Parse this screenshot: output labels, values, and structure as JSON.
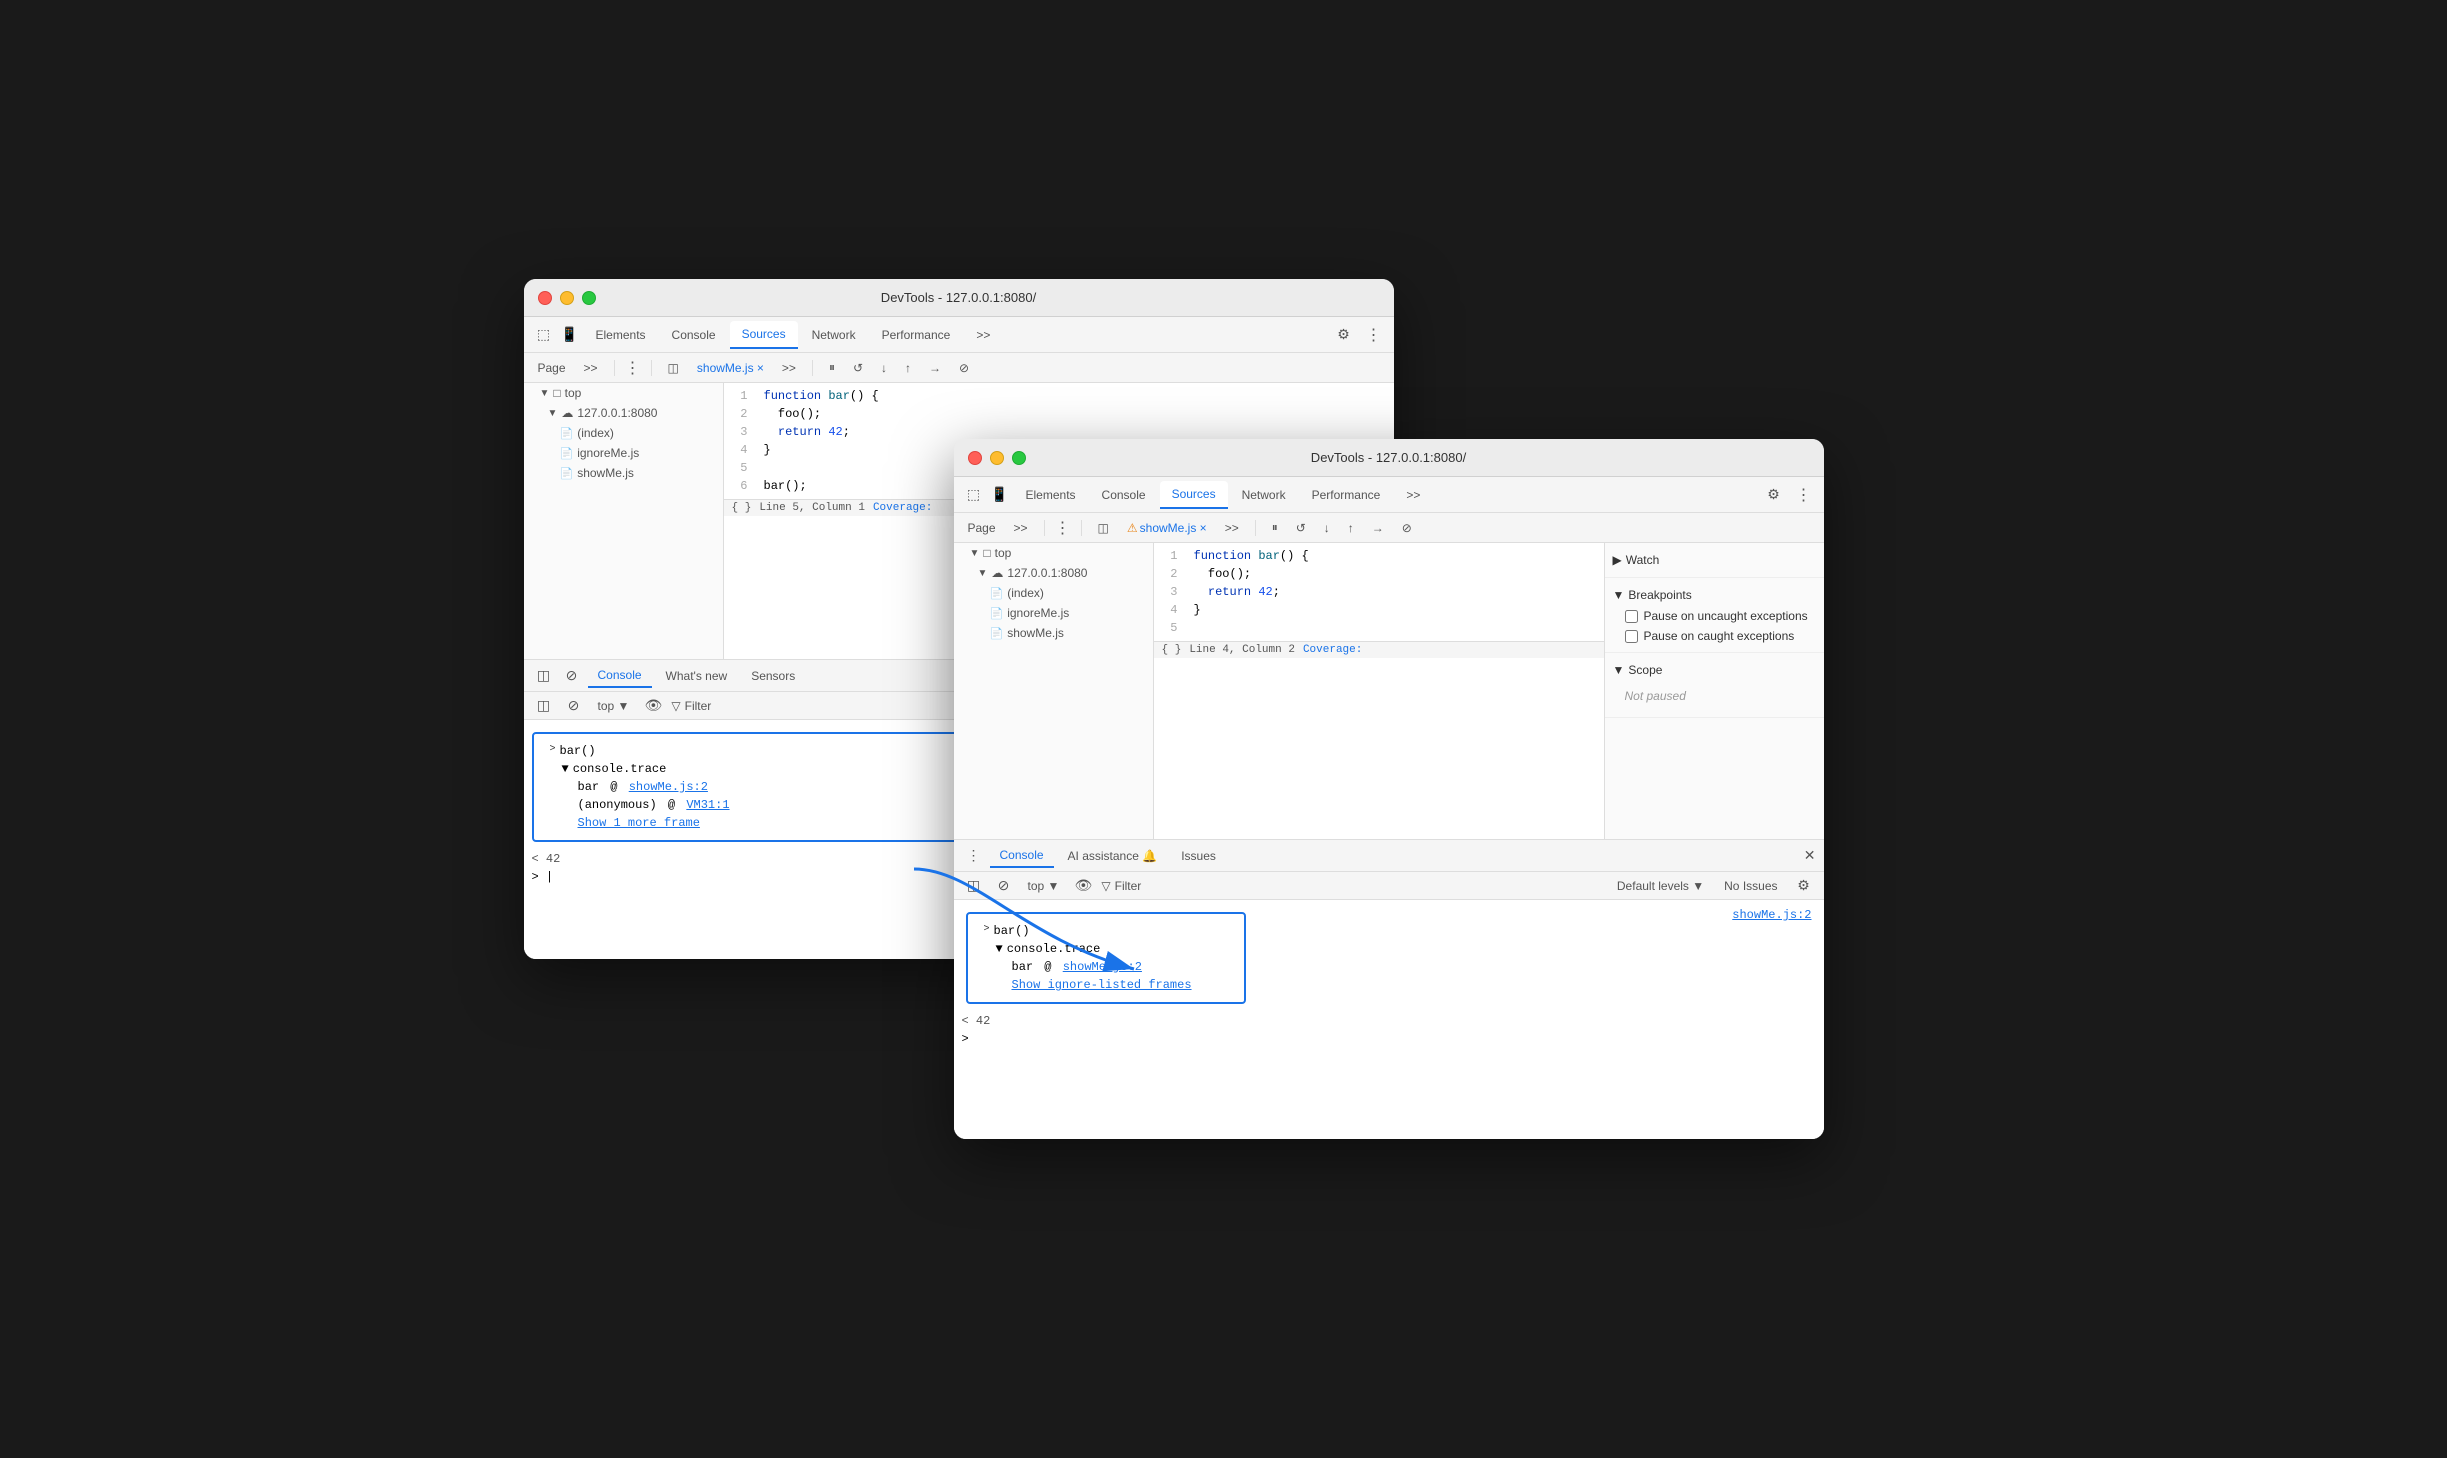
{
  "back_window": {
    "title": "DevTools - 127.0.0.1:8080/",
    "tabs": [
      "Elements",
      "Console",
      "Sources",
      "Network",
      "Performance"
    ],
    "active_tab": "Sources",
    "sidebar": {
      "items": [
        {
          "label": "top",
          "type": "root",
          "indent": 0
        },
        {
          "label": "127.0.0.1:8080",
          "type": "server",
          "indent": 1
        },
        {
          "label": "(index)",
          "type": "file",
          "indent": 2
        },
        {
          "label": "ignoreMe.js",
          "type": "file-orange",
          "indent": 2
        },
        {
          "label": "showMe.js",
          "type": "file-orange",
          "indent": 2
        }
      ]
    },
    "file_tab": "showMe.js",
    "code": [
      {
        "line": 1,
        "content": "function bar() {"
      },
      {
        "line": 2,
        "content": "  foo();"
      },
      {
        "line": 3,
        "content": "  return 42;"
      },
      {
        "line": 4,
        "content": "}"
      },
      {
        "line": 5,
        "content": ""
      },
      {
        "line": 6,
        "content": "bar();"
      }
    ],
    "status_bar": "Line 5, Column 1  Coverage:",
    "console": {
      "tabs": [
        "Console",
        "What's new",
        "Sensors"
      ],
      "active_tab": "Console",
      "toolbar": {
        "top_label": "top",
        "filter_label": "Filter"
      },
      "entries": [
        {
          "type": "group-start",
          "text": "> bar()"
        },
        {
          "type": "group-item",
          "indent": 1,
          "text": "▼ console.trace"
        },
        {
          "type": "group-item",
          "indent": 2,
          "label": "bar",
          "at": "@",
          "link": "showMe.js:2"
        },
        {
          "type": "group-item",
          "indent": 2,
          "label": "(anonymous)",
          "at": "@",
          "link": "VM31:1"
        },
        {
          "type": "group-item",
          "indent": 2,
          "link": "Show 1 more frame"
        },
        {
          "type": "result",
          "text": "< 42"
        },
        {
          "type": "cursor",
          "text": "> |"
        }
      ]
    }
  },
  "front_window": {
    "title": "DevTools - 127.0.0.1:8080/",
    "tabs": [
      "Elements",
      "Console",
      "Sources",
      "Network",
      "Performance"
    ],
    "active_tab": "Sources",
    "sidebar": {
      "items": [
        {
          "label": "top",
          "type": "root",
          "indent": 0
        },
        {
          "label": "127.0.0.1:8080",
          "type": "server",
          "indent": 1
        },
        {
          "label": "(index)",
          "type": "file",
          "indent": 2
        },
        {
          "label": "ignoreMe.js",
          "type": "file-orange",
          "indent": 2
        },
        {
          "label": "showMe.js",
          "type": "file-orange",
          "indent": 2
        }
      ]
    },
    "file_tab": "showMe.js",
    "code": [
      {
        "line": 1,
        "content": "function bar() {"
      },
      {
        "line": 2,
        "content": "  foo();"
      },
      {
        "line": 3,
        "content": "  return 42;"
      },
      {
        "line": 4,
        "content": "}"
      },
      {
        "line": 5,
        "content": ""
      }
    ],
    "status_bar": "Line 4, Column 2  Coverage:",
    "right_panel": {
      "sections": [
        {
          "label": "Watch",
          "collapsed": true
        },
        {
          "label": "Breakpoints",
          "collapsed": false
        },
        {
          "label": "Scope",
          "collapsed": false
        }
      ],
      "breakpoints": {
        "pause_uncaught": "Pause on uncaught exceptions",
        "pause_caught": "Pause on caught exceptions"
      },
      "scope_status": "Not paused"
    },
    "console": {
      "tabs": [
        "Console",
        "AI assistance",
        "Issues"
      ],
      "active_tab": "Console",
      "toolbar": {
        "top_label": "top",
        "filter_label": "Filter",
        "levels_label": "Default levels",
        "no_issues": "No Issues"
      },
      "entries": [
        {
          "type": "group-start",
          "text": "> bar()"
        },
        {
          "type": "group-item",
          "indent": 1,
          "text": "▼ console.trace"
        },
        {
          "type": "group-item",
          "indent": 2,
          "label": "bar",
          "at": "@",
          "link": "showMe.js:2"
        },
        {
          "type": "group-item",
          "indent": 2,
          "link": "Show ignore-listed frames"
        },
        {
          "type": "result",
          "text": "< 42"
        },
        {
          "type": "cursor",
          "text": ">"
        }
      ],
      "right_link": "showMe.js:2"
    }
  },
  "icons": {
    "devtools": "⚙",
    "more": "⋮",
    "search": "🔍",
    "sidebar_toggle": "◫",
    "file": "📄",
    "folder": "📁"
  }
}
